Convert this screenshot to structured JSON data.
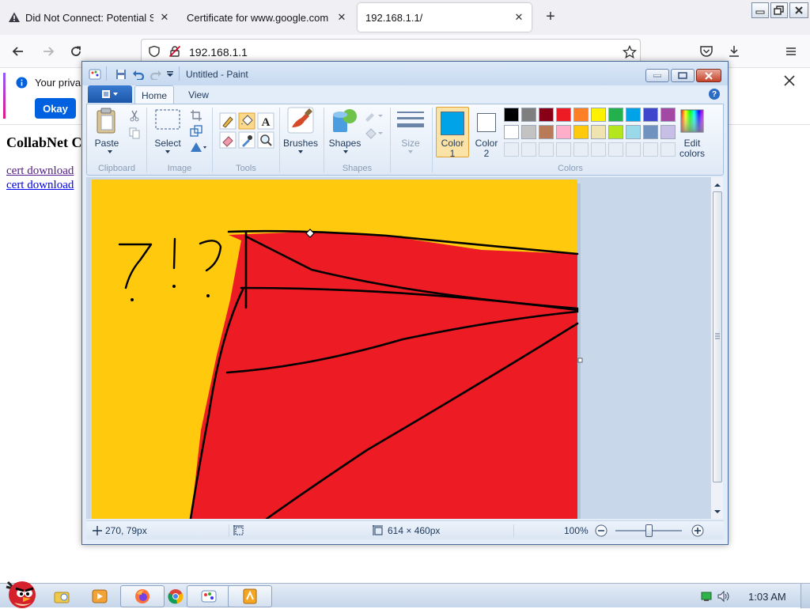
{
  "browser": {
    "tabs": [
      {
        "title": "Did Not Connect: Potential S",
        "close": "✕",
        "warning": true
      },
      {
        "title": "Certificate for www.google.com",
        "close": "✕"
      },
      {
        "title": "192.168.1.1/",
        "close": "✕",
        "active": true
      }
    ],
    "new_tab": "+",
    "url": "192.168.1.1"
  },
  "page": {
    "notice_text": "Your priva",
    "okay_label": "Okay",
    "title": "CollabNet C",
    "links": [
      "cert download",
      "cert download"
    ],
    "link_colors": [
      "#551a8b",
      "#0000ee"
    ]
  },
  "paint": {
    "title": "Untitled - Paint",
    "tabs": [
      "Home",
      "View"
    ],
    "groups": [
      "Clipboard",
      "Image",
      "Tools",
      "Shapes",
      "Colors"
    ],
    "buttons": {
      "paste": "Paste",
      "select": "Select",
      "brushes": "Brushes",
      "shapes": "Shapes",
      "size": "Size",
      "color1": "Color\n1",
      "color2": "Color\n2",
      "edit_colors": "Edit\ncolors"
    },
    "color1_value": "#00a2e8",
    "color2_value": "#ffffff",
    "palette_row1": [
      "#000000",
      "#7f7f7f",
      "#880015",
      "#ed1c24",
      "#ff7f27",
      "#fff200",
      "#22b14c",
      "#00a2e8",
      "#3f48cc",
      "#a349a4"
    ],
    "palette_row2": [
      "#ffffff",
      "#c3c3c3",
      "#b97a57",
      "#ffaec9",
      "#ffc90e",
      "#efe4b0",
      "#b5e61d",
      "#99d9ea",
      "#7092be",
      "#c8bfe7"
    ],
    "canvas_bg": "#ffc90e",
    "canvas_fill": "#ed1c24",
    "status": {
      "cursor": "270, 79px",
      "size": "614 × 460px",
      "zoom": "100%"
    }
  },
  "taskbar": {
    "clock": "1:03 AM"
  }
}
